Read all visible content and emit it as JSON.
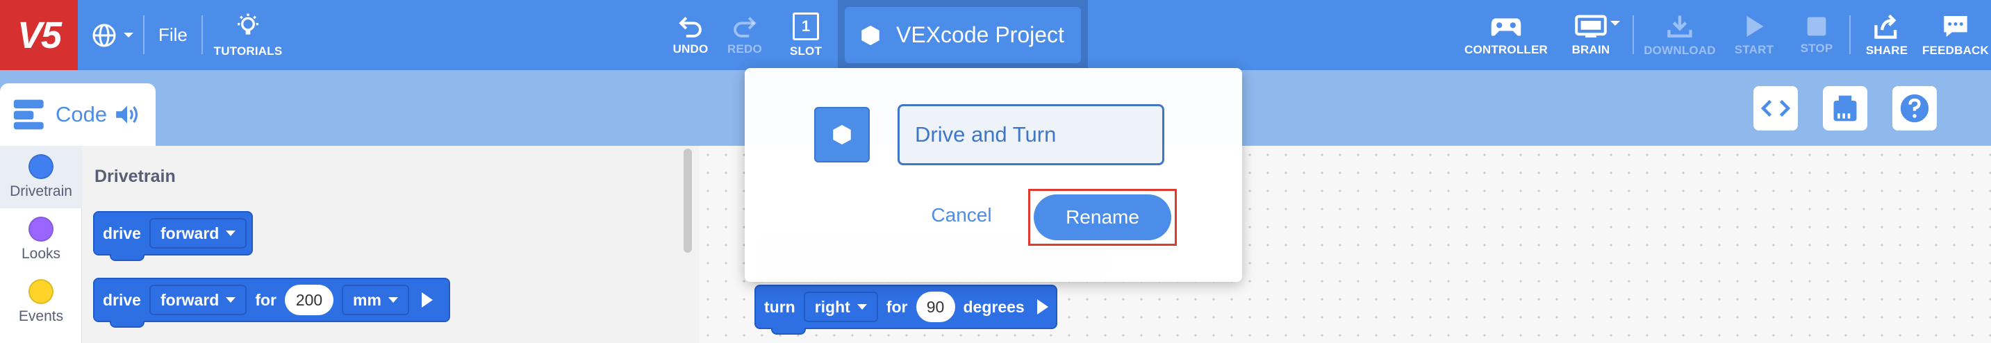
{
  "toolbar": {
    "logo": "V5",
    "file_label": "File",
    "tutorials_label": "TUTORIALS",
    "undo_label": "UNDO",
    "redo_label": "REDO",
    "slot_label": "SLOT",
    "slot_number": "1",
    "project_name": "VEXcode Project",
    "controller_label": "CONTROLLER",
    "brain_label": "BRAIN",
    "download_label": "DOWNLOAD",
    "start_label": "START",
    "stop_label": "STOP",
    "share_label": "SHARE",
    "feedback_label": "FEEDBACK"
  },
  "code_tab": {
    "label": "Code"
  },
  "categories": [
    {
      "label": "Drivetrain",
      "color": "#3f7ff0"
    },
    {
      "label": "Looks",
      "color": "#9966ff"
    },
    {
      "label": "Events",
      "color": "#ffd42a"
    }
  ],
  "flyout": {
    "title": "Drivetrain",
    "block1": {
      "word": "drive",
      "direction": "forward"
    },
    "block2": {
      "word": "drive",
      "direction": "forward",
      "for_word": "for",
      "amount": "200",
      "unit": "mm"
    }
  },
  "workspace": {
    "turn_block": {
      "word": "turn",
      "direction": "right",
      "for_word": "for",
      "amount": "90",
      "unit": "degrees"
    }
  },
  "dialog": {
    "input_value": "Drive and Turn",
    "cancel_label": "Cancel",
    "rename_label": "Rename"
  },
  "colors": {
    "toolbar": "#4c8de9",
    "logo": "#d63031",
    "block": "#2f6fe4",
    "highlight": "#e03a2e"
  }
}
